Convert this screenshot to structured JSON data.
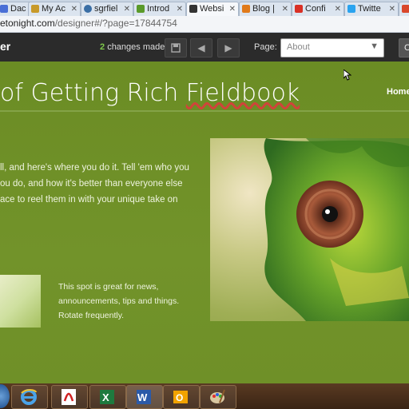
{
  "browser": {
    "tabs": [
      {
        "label": "Dac",
        "favicon_color": "#4a6fd6"
      },
      {
        "label": "My Ac",
        "favicon_color": "#c89a2a"
      },
      {
        "label": "sgrfiel",
        "favicon_color": "#3a6ea5"
      },
      {
        "label": "Introd",
        "favicon_color": "#5a9a2a"
      },
      {
        "label": "Websi",
        "favicon_color": "#333333"
      },
      {
        "label": "Blog |",
        "favicon_color": "#e07a1a"
      },
      {
        "label": "Confi",
        "favicon_color": "#d93025"
      },
      {
        "label": "Twitte",
        "favicon_color": "#2aa3ef"
      }
    ],
    "address_host": "etonight.com",
    "address_path": "/designer#/?page=17844754"
  },
  "toolbar": {
    "brand": "er",
    "changes_count": "2",
    "changes_label": "changes made",
    "page_label": "Page:",
    "page_value": "About",
    "right_button_label": "C"
  },
  "site": {
    "title_prefix": "of Getting Rich ",
    "title_word": "Fieldbook",
    "nav_home": "Home",
    "intro_lines": [
      "ll, and here's where you do it. Tell 'em who you",
      "ou do, and how it's better than everyone else",
      "ace to reel them in with your unique take on"
    ],
    "news_lines": [
      "This spot is great for news,",
      "announcements, tips and things.",
      "Rotate frequently."
    ]
  },
  "colors": {
    "site_green": "#6e8f26",
    "toolbar_dark": "#2b2b2b",
    "changes_green": "#7ec84a"
  },
  "taskbar": {
    "items": [
      "start-orb-icon",
      "internet-explorer-icon",
      "acrobat-icon",
      "excel-icon",
      "word-icon",
      "outlook-icon",
      "paint-icon"
    ]
  }
}
